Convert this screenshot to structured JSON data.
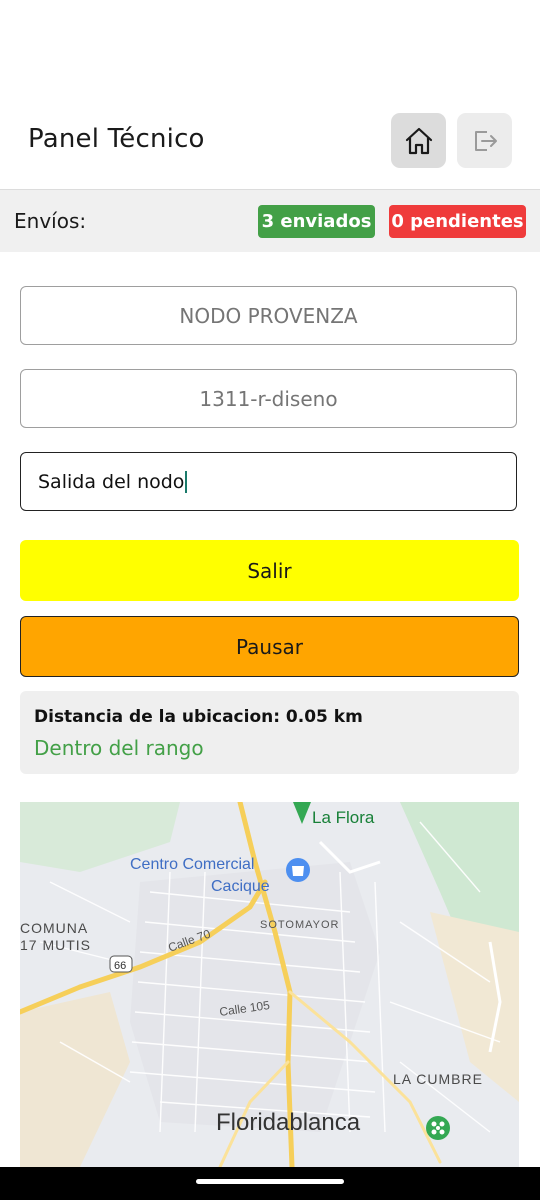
{
  "header": {
    "title": "Panel Técnico",
    "home_icon": "home-icon",
    "logout_icon": "logout-icon"
  },
  "summary": {
    "label": "Envíos:",
    "sent": "3 enviados",
    "pending": "0 pendientes",
    "sent_color": "#43a047",
    "pending_color": "#ef3b3b"
  },
  "form": {
    "node": "NODO PROVENZA",
    "project": "1311-r-diseno",
    "activity": "Salida del nodo"
  },
  "actions": {
    "exit_label": "Salir",
    "pause_label": "Pausar",
    "exit_color": "#ffff00",
    "pause_color": "#ffa500"
  },
  "info": {
    "distance": "Distancia de la ubicacion: 0.05 km",
    "status": "Dentro del rango",
    "status_color": "#43a047"
  },
  "map": {
    "labels": {
      "la_flora": "La Flora",
      "mall_line1": "Centro Comercial",
      "mall_line2": "Cacique",
      "comuna_line1": "COMUNA",
      "comuna_line2": "17 MUTIS",
      "sotomayor": "SOTOMAYOR",
      "calle70": "Calle 70",
      "route66": "66",
      "calle105": "Calle 105",
      "la_cumbre": "LA CUMBRE",
      "floridablanca": "Floridablanca"
    }
  }
}
